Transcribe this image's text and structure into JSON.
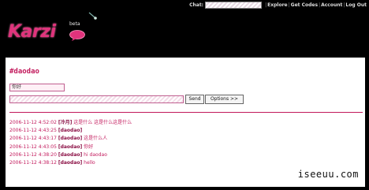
{
  "topnav": {
    "chat_label": "Chat:",
    "links": [
      "Explore",
      "Get Codes",
      "Account",
      "Log Out"
    ],
    "separator": "|"
  },
  "logo": {
    "brand": "Karzi",
    "badge": "beta"
  },
  "channel": {
    "name": "#daodao"
  },
  "compose": {
    "nickname": "你好",
    "send_label": "Send",
    "options_label": "Options >>"
  },
  "log": [
    {
      "time": "2006-11-12 4:52:02",
      "user": "[冷月]",
      "text": "这是什么 这是什么这是什么"
    },
    {
      "time": "2006-11-12 4:43:25",
      "user": "[daodao]",
      "text": ""
    },
    {
      "time": "2006-11-12 4:43:17",
      "user": "[daodao]",
      "text": "这是什么人"
    },
    {
      "time": "2006-11-12 4:43:05",
      "user": "[daodao]",
      "text": "你好"
    },
    {
      "time": "2006-11-12 4:38:20",
      "user": "[daodao]",
      "text": "hi daodao"
    },
    {
      "time": "2006-11-12 4:38:12",
      "user": "[daodao]",
      "text": "hello"
    }
  ],
  "watermark": "iseeuu.com",
  "colors": {
    "accent": "#c2185b",
    "brand": "#e0337c",
    "background": "#000000"
  }
}
